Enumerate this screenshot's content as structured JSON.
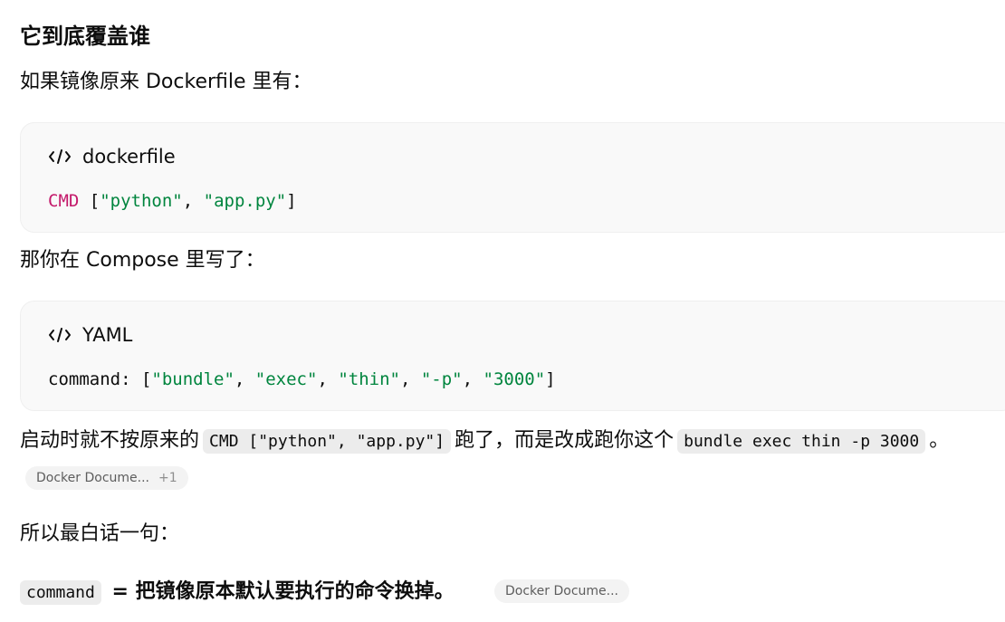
{
  "heading": "它到底覆盖谁",
  "para1": "如果镜像原来 Dockerfile 里有：",
  "block1": {
    "lang": "dockerfile",
    "icon": "code-icon",
    "tokens": {
      "cmd": "CMD",
      "open": " [",
      "s1": "\"python\"",
      "comma": ", ",
      "s2": "\"app.py\"",
      "close": "]"
    }
  },
  "para2": "那你在 Compose 里写了：",
  "block2": {
    "lang": "YAML",
    "icon": "code-icon",
    "tokens": {
      "key": "command: [",
      "s1": "\"bundle\"",
      "c1": ", ",
      "s2": "\"exec\"",
      "c2": ", ",
      "s3": "\"thin\"",
      "c3": ", ",
      "s4": "\"-p\"",
      "c4": ", ",
      "s5": "\"3000\"",
      "close": "]"
    }
  },
  "para3": {
    "before": "启动时就不按原来的",
    "code1": "CMD [\"python\", \"app.py\"]",
    "middle": "跑了，而是改成跑你这个",
    "code2": "bundle exec thin -p 3000",
    "after": "。"
  },
  "source_pill_1": {
    "label": "Docker Docume...",
    "count": "+1"
  },
  "para4": "所以最白话一句：",
  "para5": {
    "code": "command",
    "text": "= 把镜像原本默认要执行的命令换掉。"
  },
  "source_pill_2": {
    "label": "Docker Docume..."
  }
}
